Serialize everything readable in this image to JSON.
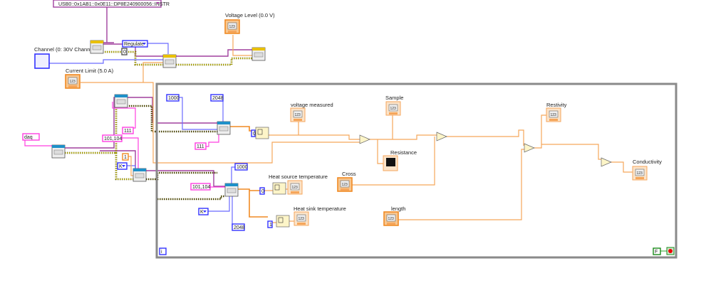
{
  "visa_resource": "USB0::0x1AB1::0x0E11::DP8E240900056::INSTR",
  "controls": {
    "voltage_level": "Voltage Level (0.0 V)",
    "channel": "Channel (0: 30V Channel)",
    "current_limit": "Current Limit (5.0 A)",
    "cross": "Cross",
    "length": "length"
  },
  "indicators": {
    "voltage_measured": "voltage measured",
    "sample": "Sample",
    "resistance": "Resistance",
    "heat_source_temperature": "Heat source temperature",
    "heat_sink_temperature": "Heat sink temperature",
    "restivity": "Restivity",
    "conductivity": "Conductivity"
  },
  "constants": {
    "regulate": "Regulate",
    "zero_top": "0",
    "daq": "daq",
    "ch_111_outer": "111",
    "ch_101_104_outer": "101,104",
    "one_outer": "1",
    "k_outer": "K",
    "rate_1000_a": "1000",
    "samples_2048_a": "2048",
    "ch_111_inner": "111",
    "index_0_a": "0",
    "rate_1000_b": "1000",
    "ch_101_104_inner": "101,104",
    "k_inner": "K",
    "samples_2048_b": "2048",
    "index_0_b": "0",
    "index_1": "1",
    "stop_false": "F",
    "numeric_glyph": "123",
    "iteration": "i"
  },
  "colors": {
    "numeric_wire": "#f5a65b",
    "string_wire": "#ff3fe0",
    "visa_wire": "#a0419e",
    "enum_wire": "#6a6aff",
    "error_wire": "#4a4400",
    "loop_border": "#8a8a8a"
  }
}
